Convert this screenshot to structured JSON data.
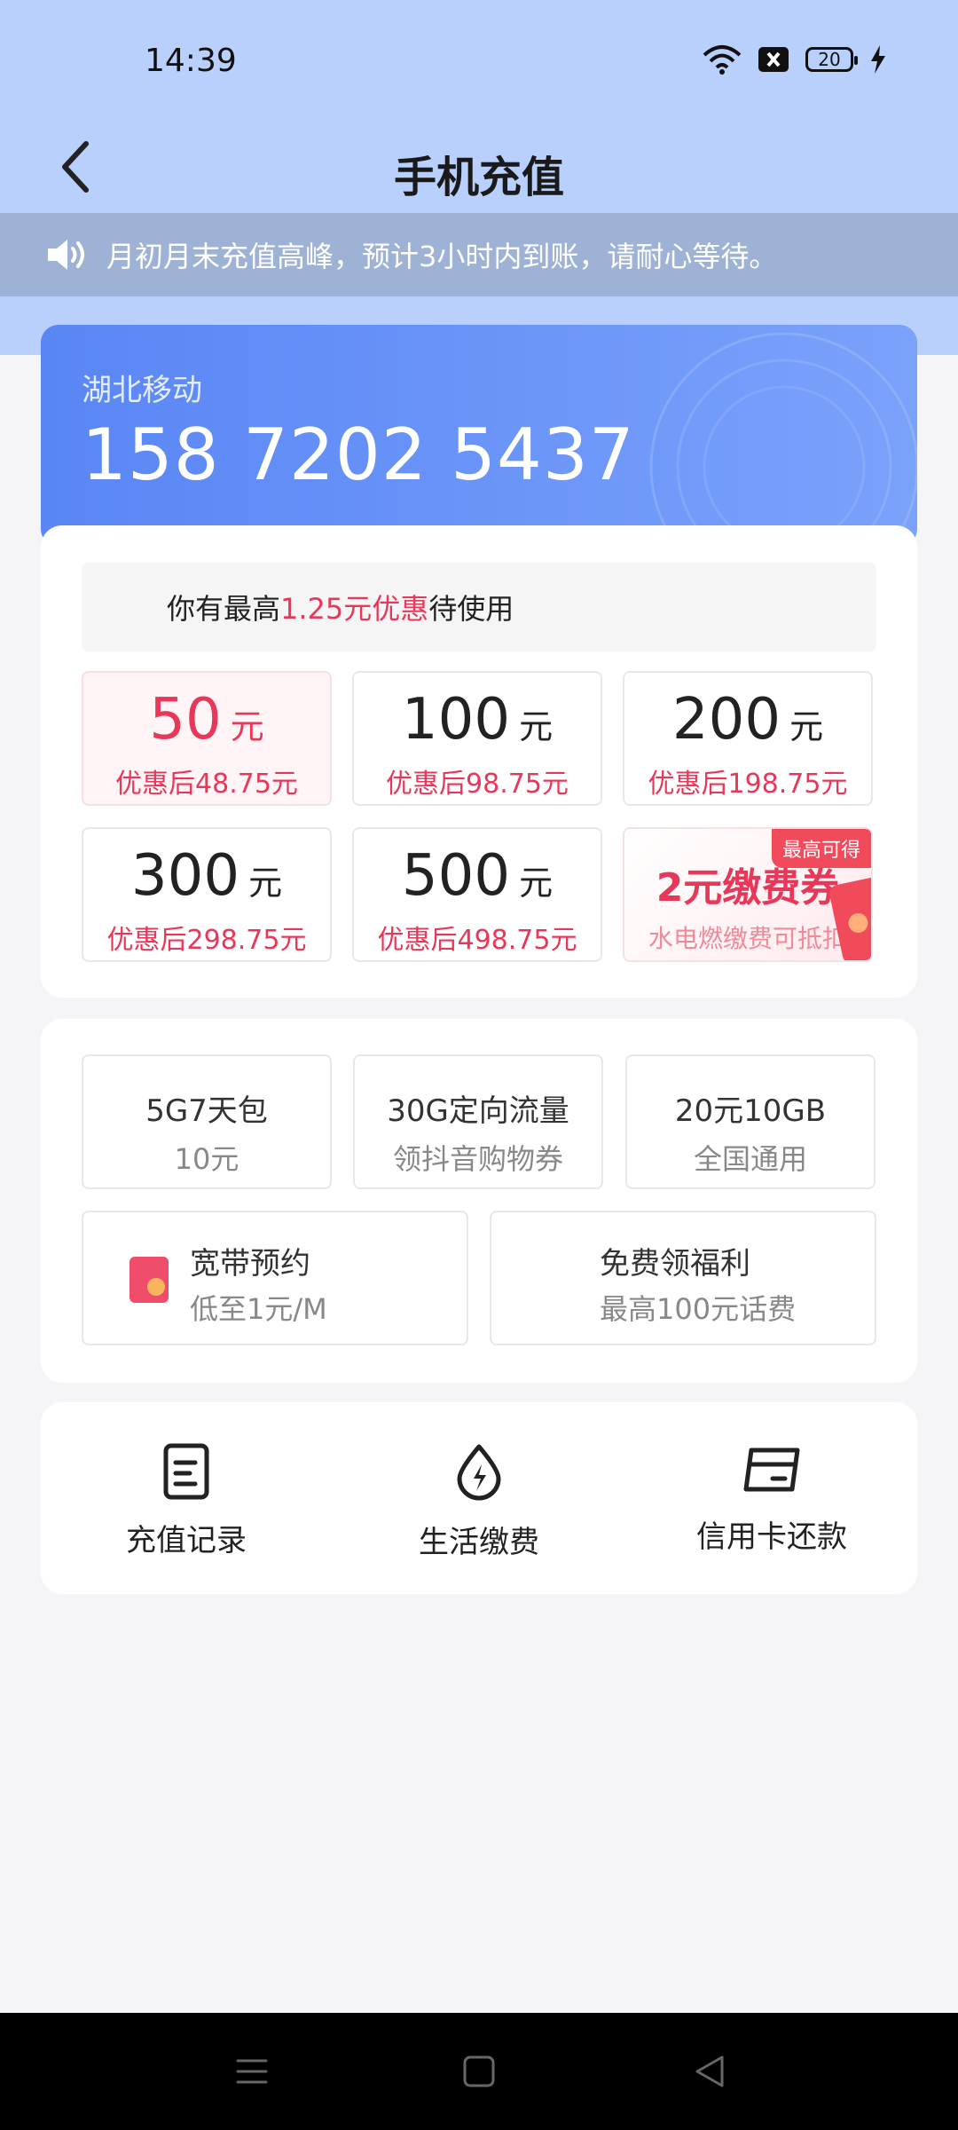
{
  "status_bar": {
    "time": "14:39",
    "battery_level": "20",
    "icons": [
      "wifi-icon",
      "close-box-icon",
      "battery-icon",
      "charging-bolt-icon"
    ]
  },
  "header": {
    "title": "手机充值",
    "back_icon": "chevron-left-icon"
  },
  "notice": {
    "icon": "speaker-icon",
    "text": "月初月末充值高峰，预计3小时内到账，请耐心等待。"
  },
  "account": {
    "carrier": "湖北移动",
    "phone_number": "158 7202 5437"
  },
  "discount_banner": {
    "prefix": "你有最高",
    "highlight": "1.25元优惠",
    "suffix": "待使用"
  },
  "amounts": [
    {
      "value": "50",
      "unit": "元",
      "after": "优惠后48.75元",
      "selected": true
    },
    {
      "value": "100",
      "unit": "元",
      "after": "优惠后98.75元"
    },
    {
      "value": "200",
      "unit": "元",
      "after": "优惠后198.75元"
    },
    {
      "value": "300",
      "unit": "元",
      "after": "优惠后298.75元"
    },
    {
      "value": "500",
      "unit": "元",
      "after": "优惠后498.75元"
    }
  ],
  "coupon": {
    "tag": "最高可得",
    "title": "2元缴费券",
    "subtitle": "水电燃缴费可抵扣"
  },
  "packages": [
    {
      "title": "5G7天包",
      "subtitle": "10元"
    },
    {
      "title": "30G定向流量",
      "subtitle": "领抖音购物券"
    },
    {
      "title": "20元10GB",
      "subtitle": "全国通用"
    }
  ],
  "wide_packages": [
    {
      "title": "宽带预约",
      "subtitle": "低至1元/M",
      "icon": "red-envelope-icon"
    },
    {
      "title": "免费领福利",
      "subtitle": "最高100元话费"
    }
  ],
  "quick_actions": [
    {
      "label": "充值记录",
      "icon": "document-icon"
    },
    {
      "label": "生活缴费",
      "icon": "utility-drop-icon"
    },
    {
      "label": "信用卡还款",
      "icon": "credit-card-icon"
    }
  ],
  "system_nav": [
    "menu-icon",
    "home-icon",
    "back-triangle-icon"
  ],
  "colors": {
    "accent_red": "#e8385a",
    "header_bg": "#b8d0fb",
    "card_blue": "#5a86f5"
  }
}
